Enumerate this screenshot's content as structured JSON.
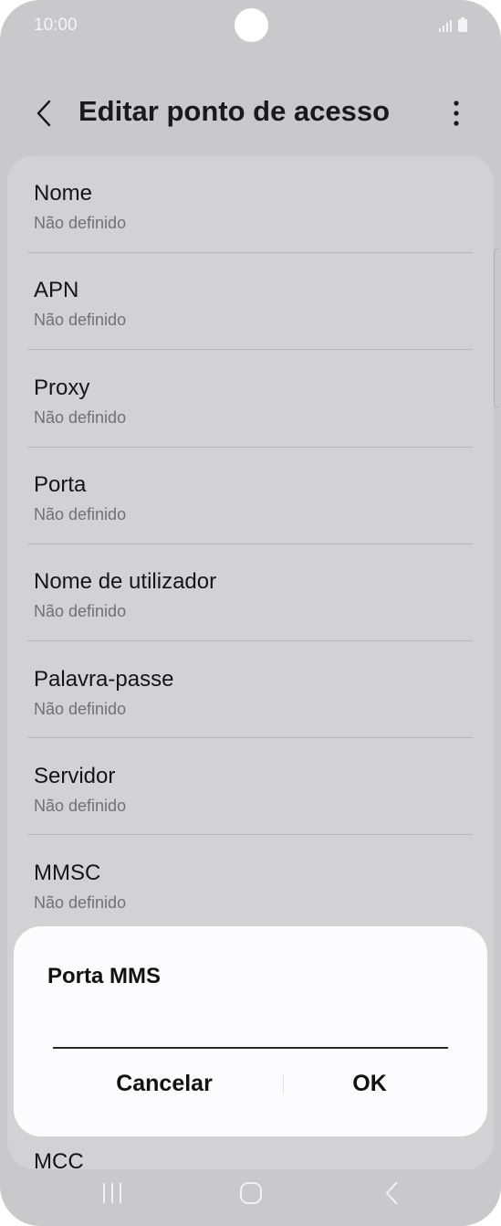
{
  "status": {
    "time": "10:00"
  },
  "header": {
    "title": "Editar ponto de acesso"
  },
  "items": [
    {
      "title": "Nome",
      "value": "Não definido"
    },
    {
      "title": "APN",
      "value": "Não definido"
    },
    {
      "title": "Proxy",
      "value": "Não definido"
    },
    {
      "title": "Porta",
      "value": "Não definido"
    },
    {
      "title": "Nome de utilizador",
      "value": "Não definido"
    },
    {
      "title": "Palavra-passe",
      "value": "Não definido"
    },
    {
      "title": "Servidor",
      "value": "Não definido"
    },
    {
      "title": "MMSC",
      "value": "Não definido"
    },
    {
      "title": "MCC",
      "value": ""
    }
  ],
  "dialog": {
    "title": "Porta MMS",
    "input_value": "",
    "cancel_label": "Cancelar",
    "ok_label": "OK"
  },
  "icons": {
    "back": "chevron-left-icon",
    "more": "more-vertical-icon",
    "nav_recents": "recents-icon",
    "nav_home": "home-icon",
    "nav_back": "back-icon"
  }
}
